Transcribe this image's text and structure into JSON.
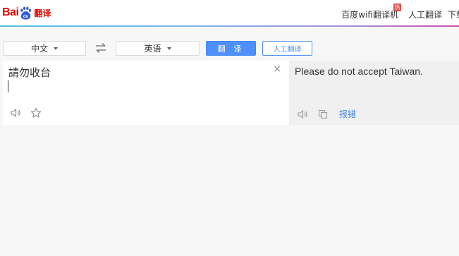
{
  "header": {
    "logo_text_left": "Bai",
    "logo_text_paw": "du",
    "logo_text_right": "翻译",
    "nav": [
      {
        "label": "百度wifi翻译机",
        "badge": "热"
      },
      {
        "label": "人工翻译"
      },
      {
        "label": "下载"
      }
    ]
  },
  "toolbar": {
    "source_lang": "中文",
    "target_lang": "英语",
    "translate_label": "翻 译",
    "human_translate_label": "人工翻译"
  },
  "input": {
    "text": "請勿收台",
    "clear_symbol": "×"
  },
  "output": {
    "text": "Please do not accept Taiwan.",
    "report_label": "报错"
  },
  "colors": {
    "brand_red": "#e10602",
    "accent_blue": "#4d90fe",
    "badge_red": "#e44a4a"
  },
  "icons": {
    "swap": "swap-languages-icon",
    "speaker": "speaker-icon",
    "star": "star-icon",
    "copy": "copy-icon"
  }
}
